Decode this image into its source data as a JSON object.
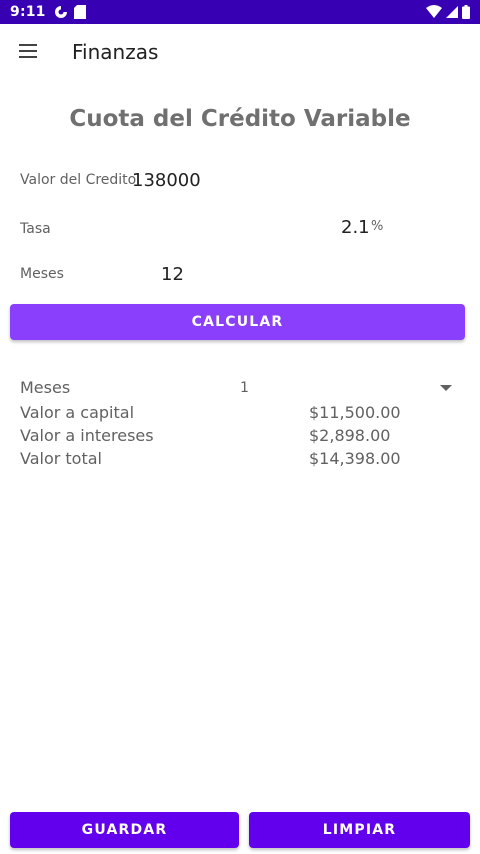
{
  "status_bar": {
    "time": "9:11",
    "left_icons": [
      "privacy-icon",
      "sd-card-icon"
    ],
    "right_icons": [
      "wifi-icon",
      "signal-icon",
      "battery-icon"
    ],
    "background": "#3700b3"
  },
  "app_bar": {
    "menu_icon": "menu-icon",
    "title": "Finanzas"
  },
  "screen": {
    "title": "Cuota del Crédito Variable"
  },
  "form": {
    "valor_credito": {
      "label": "Valor del Credito",
      "value": "138000"
    },
    "tasa": {
      "label": "Tasa",
      "value": "2.1",
      "suffix": "%"
    },
    "meses": {
      "label": "Meses",
      "value": "12"
    }
  },
  "calculate_button": {
    "label": "CALCULAR",
    "color": "#8a3ffc"
  },
  "results": {
    "meses_label": "Meses",
    "meses_selected": "1",
    "rows": [
      {
        "label": "Valor a capital",
        "value": "$11,500.00"
      },
      {
        "label": "Valor a intereses",
        "value": "$2,898.00"
      },
      {
        "label": "Valor total",
        "value": "$14,398.00"
      }
    ]
  },
  "bottom_buttons": {
    "guardar": "GUARDAR",
    "limpiar": "LIMPIAR",
    "color": "#6200ee"
  }
}
